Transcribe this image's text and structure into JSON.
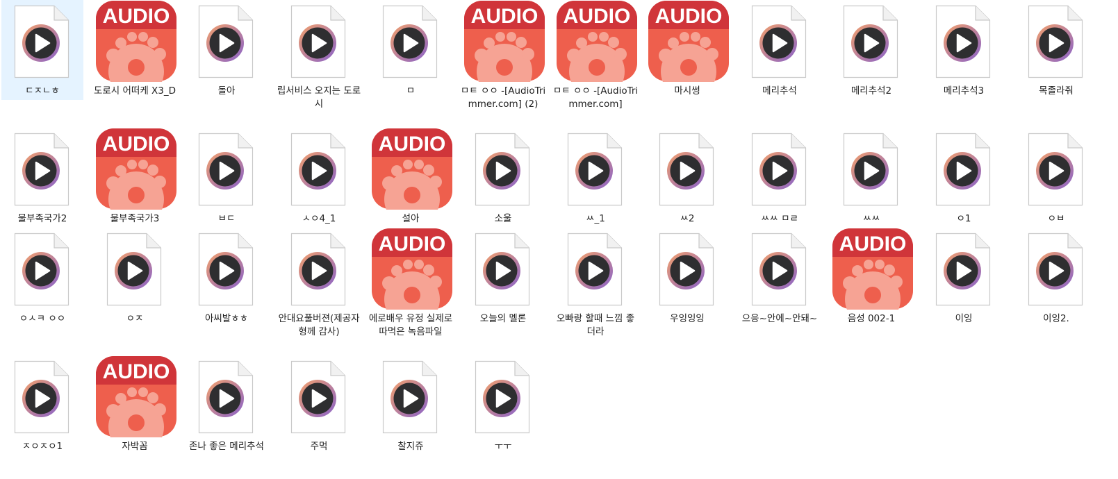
{
  "colors": {
    "selection": "#e5f3ff",
    "audio_header": "#d0353a",
    "audio_body": "#ee5f4d",
    "audio_paw": "#f6a394",
    "play_ring_a": "#f2a06c",
    "play_ring_b": "#8a63c9",
    "play_disc": "#2e2e30"
  },
  "icons": {
    "generic": "media-file-icon",
    "audio": "audio-app-icon"
  },
  "audio_badge_text": "AUDIO",
  "files": [
    {
      "name": "ㄷㅈㄴㅎ",
      "icon": "media",
      "selected": true
    },
    {
      "name": "도로시 어떠케 X3_D",
      "icon": "audio"
    },
    {
      "name": "돌아",
      "icon": "media"
    },
    {
      "name": "립서비스 오지는 도로시",
      "icon": "media"
    },
    {
      "name": "ㅁ",
      "icon": "media"
    },
    {
      "name": "ㅁㅌ ㅇㅇ -[AudioTrimmer.com] (2)",
      "icon": "audio"
    },
    {
      "name": "ㅁㅌ ㅇㅇ -[AudioTrimmer.com]",
      "icon": "audio"
    },
    {
      "name": "마시썽",
      "icon": "audio"
    },
    {
      "name": "메리추석",
      "icon": "media"
    },
    {
      "name": "메리추석2",
      "icon": "media"
    },
    {
      "name": "메리추석3",
      "icon": "media"
    },
    {
      "name": "목졸라줘",
      "icon": "media"
    },
    {
      "name": "물부족국가2",
      "icon": "media"
    },
    {
      "name": "물부족국가3",
      "icon": "audio"
    },
    {
      "name": "ㅂㄷ",
      "icon": "media"
    },
    {
      "name": "ㅅㅇ4_1",
      "icon": "media"
    },
    {
      "name": "설아",
      "icon": "audio"
    },
    {
      "name": "소울",
      "icon": "media"
    },
    {
      "name": "ㅆ_1",
      "icon": "media"
    },
    {
      "name": "ㅆ2",
      "icon": "media"
    },
    {
      "name": "ㅆㅆ ㅁㄹ",
      "icon": "media"
    },
    {
      "name": "ㅆㅆ",
      "icon": "media"
    },
    {
      "name": "ㅇ1",
      "icon": "media"
    },
    {
      "name": "ㅇㅂ",
      "icon": "media"
    },
    {
      "name": "ㅇㅅㅋ ㅇㅇ",
      "icon": "media"
    },
    {
      "name": "ㅇㅈ",
      "icon": "media"
    },
    {
      "name": "아씨발ㅎㅎ",
      "icon": "media"
    },
    {
      "name": "안대요풀버젼(제공자형께 감사)",
      "icon": "media"
    },
    {
      "name": "에로배우 유정 실제로 따먹은 녹음파일",
      "icon": "audio"
    },
    {
      "name": "오늘의 멜론",
      "icon": "media"
    },
    {
      "name": "오빠랑 할때 느낌 좋더라",
      "icon": "media"
    },
    {
      "name": "우잉잉잉",
      "icon": "media"
    },
    {
      "name": "으응~안에~안돼~",
      "icon": "media"
    },
    {
      "name": "음성 002-1",
      "icon": "audio"
    },
    {
      "name": "이잉",
      "icon": "media"
    },
    {
      "name": "이잉2.",
      "icon": "media"
    },
    {
      "name": "ㅈㅇㅈㅇ1",
      "icon": "media"
    },
    {
      "name": "자박꼼",
      "icon": "audio"
    },
    {
      "name": "존나 좋은 메리추석",
      "icon": "media"
    },
    {
      "name": "주먹",
      "icon": "media"
    },
    {
      "name": "찰지쥬",
      "icon": "media"
    },
    {
      "name": "ㅜㅜ",
      "icon": "media"
    }
  ]
}
